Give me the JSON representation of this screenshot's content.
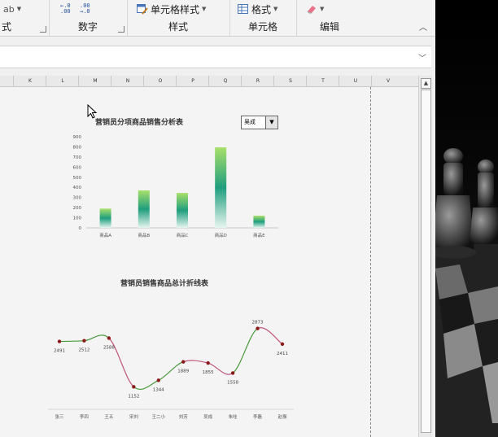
{
  "ribbon": {
    "groups": [
      {
        "label": "式"
      },
      {
        "label": "数字"
      },
      {
        "label": "样式"
      },
      {
        "label": "单元格"
      },
      {
        "label": "编辑"
      }
    ],
    "buttons": {
      "cell_style": "单元格样式",
      "format": "格式"
    },
    "num_inc": [
      ".0",
      ".00"
    ],
    "num_dec": [
      ".00",
      "→.0"
    ]
  },
  "grid": {
    "columns": [
      "K",
      "L",
      "M",
      "N",
      "O",
      "P",
      "Q",
      "R",
      "S",
      "T",
      "U",
      "V"
    ]
  },
  "charts": {
    "bar_title": "营销员分项商品销售分析表",
    "line_title": "营销员销售商品总计折线表",
    "select_value": "吴成"
  },
  "chart_data": [
    {
      "type": "bar",
      "title": "营销员分项商品销售分析表",
      "categories": [
        "商品A",
        "商品B",
        "商品C",
        "商品D",
        "商品E"
      ],
      "values": [
        190,
        370,
        345,
        795,
        120
      ],
      "ylim": [
        0,
        900
      ],
      "yticks": [
        "0",
        "100",
        "200",
        "300",
        "400",
        "500",
        "600",
        "700",
        "800",
        "900"
      ],
      "grid": false
    },
    {
      "type": "line",
      "title": "营销员销售商品总计折线表",
      "categories": [
        "张三",
        "李四",
        "王五",
        "宋刘",
        "王二小",
        "刘芳",
        "吴成",
        "朱哇",
        "李磊",
        "赵振"
      ],
      "values": [
        2491,
        2512,
        2588,
        1152,
        1344,
        1889,
        1855,
        1558,
        2873,
        2411
      ],
      "labels": [
        "2491",
        "2512",
        "2588",
        "1152",
        "1344",
        "1889",
        "1855",
        "1558",
        "2873",
        "2411"
      ],
      "colors": {
        "up": "#4a9a3c",
        "down": "#c0547e",
        "marker": "#8b1a1a"
      }
    }
  ]
}
